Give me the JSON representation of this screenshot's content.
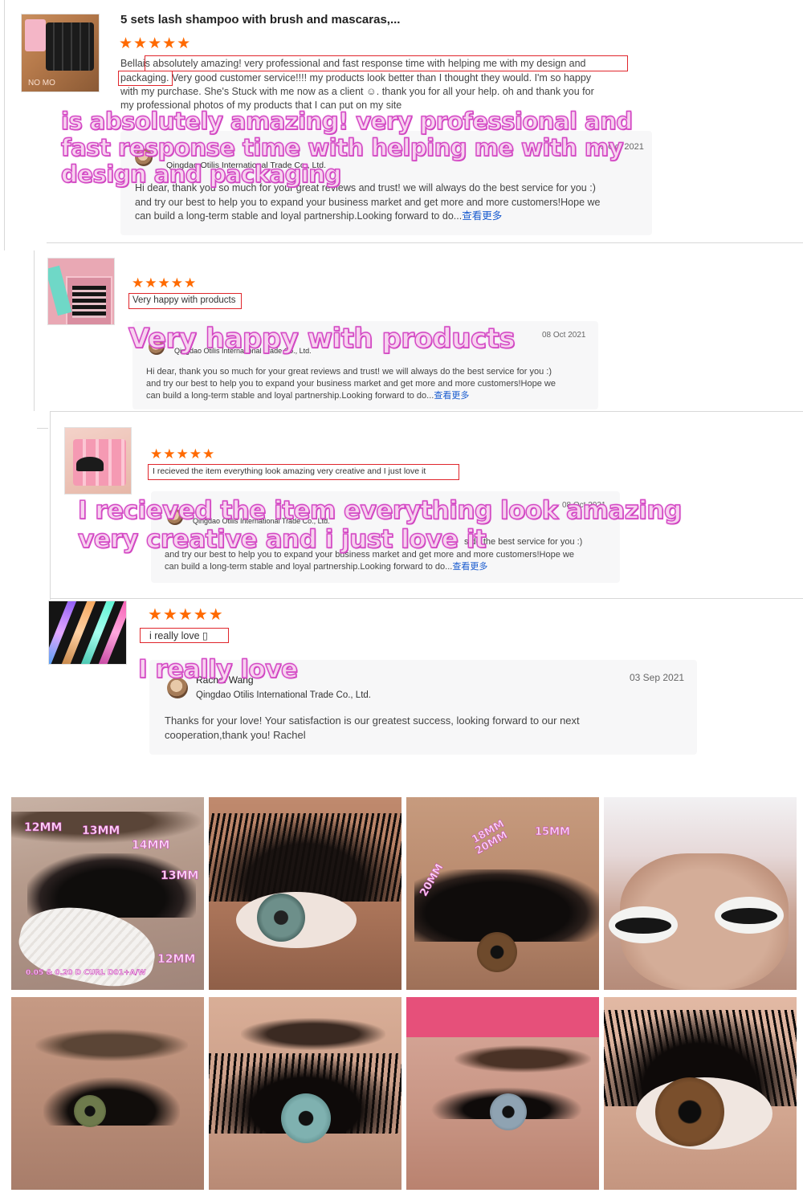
{
  "review1": {
    "product_title": "5 sets lash shampoo with brush and mascaras,...",
    "stars": "★★★★★",
    "reviewer": "Bella",
    "text_highlight": "is absolutely amazing! very professional and   fast response time with helping me with my design and",
    "text_highlight2": "packaging.",
    "text_rest": " Very good customer service!!!! my products look better than I thought they would. I'm so happy",
    "text_line3": "with my purchase. She's Stuck with me now as a client ☺. thank you for all your help. oh and thank you for",
    "text_line4": "my professional photos of my products that I can put on my site",
    "overlay": [
      "is absolutely amazing! very professional and",
      "fast response time with helping me with my",
      "design and packaging"
    ],
    "thumb_text": "NO MO",
    "reply": {
      "company": "Qingdao Otilis International Trade Co., Ltd.",
      "date": "3 Oct 2021",
      "line1": "Hi dear, thank you so much for your great reviews and trust! we will always do the best service for you :)",
      "line2": "and try our best to help you to expand your business market and get more and more customers!Hope we",
      "line3": "can build a long-term stable and loyal partnership.Looking forward to do...",
      "more": "查看更多"
    }
  },
  "review2": {
    "stars": "★★★★★",
    "text": "Very happy with products",
    "overlay": "Very happy with products",
    "reply": {
      "company": "Qingdao Otilis International Trade Co., Ltd.",
      "date": "08 Oct 2021",
      "line1": "Hi dear, thank you so much for your great reviews and trust! we will always do the best service for you :)",
      "line2": "and try our best to help you to expand your business market and get more and more customers!Hope we",
      "line3": "can build a long-term stable and loyal partnership.Looking forward to do...",
      "more": "查看更多"
    }
  },
  "review3": {
    "stars": "★★★★★",
    "text": "I recieved the item everything look amazing very creative and I just love it",
    "overlay": [
      "I recieved the item everything look amazing",
      "very creative and i just love it"
    ],
    "reply": {
      "company": "Qingdao Otilis International Trade Co., Ltd.",
      "date": "08 Oct 2021",
      "line1": "s do the best service for you :)",
      "line2": "and try our best to help you to expand your business market and get more and more customers!Hope we",
      "line3": "can build a long-term stable and loyal partnership.Looking forward to do...",
      "more": "查看更多"
    }
  },
  "review4": {
    "stars": "★★★★★",
    "text": "i really love ▯",
    "overlay": "I really love",
    "reply": {
      "name": "Rachel Wang",
      "company": "Qingdao Otilis International Trade Co., Ltd.",
      "date": "03 Sep 2021",
      "line1": "Thanks for your love! Your satisfaction is our greatest success, looking forward to our next",
      "line2": "cooperation,thank you! Rachel"
    }
  },
  "gallery": {
    "photo1_labels": [
      "12MM",
      "13MM",
      "14MM",
      "13MM",
      "12MM",
      "0.05 & 0.20 D CURL   D01+A/W"
    ],
    "photo3_labels": [
      "18MM",
      "20MM",
      "20MM",
      "15MM"
    ]
  },
  "colors": {
    "star": "#ff6a00",
    "highlight_box": "#e0262c",
    "overlay_fill": "#f7d3ef",
    "overlay_stroke": "#d347c4",
    "link": "#1a5ccf"
  }
}
